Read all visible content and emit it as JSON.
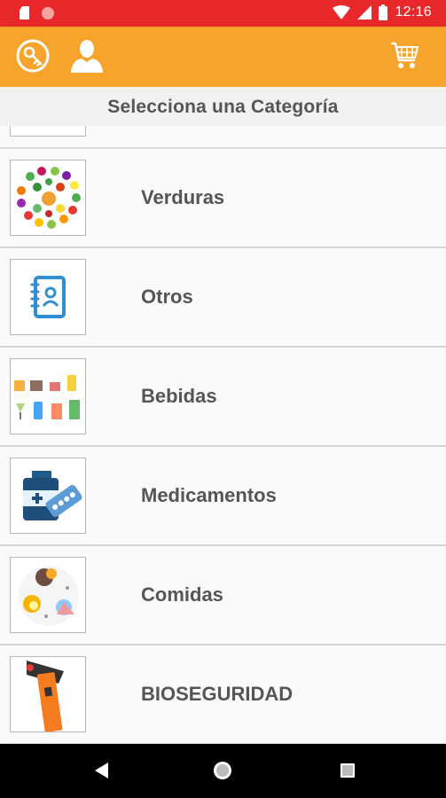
{
  "status_bar": {
    "time": "12:16",
    "color": "#e8282b"
  },
  "app_bar": {
    "color": "#f7a42d",
    "icons": [
      "key-icon",
      "user-icon",
      "cart-icon"
    ]
  },
  "header": {
    "title": "Selecciona una Categoría"
  },
  "categories": [
    {
      "label": "Verduras",
      "icon": "vegetables-image"
    },
    {
      "label": "Otros",
      "icon": "address-book-icon"
    },
    {
      "label": "Bebidas",
      "icon": "drinks-image"
    },
    {
      "label": "Medicamentos",
      "icon": "medicine-image"
    },
    {
      "label": "Comidas",
      "icon": "food-image"
    },
    {
      "label": "BIOSEGURIDAD",
      "icon": "thermometer-gun-image"
    }
  ],
  "nav_bar": {
    "icons": [
      "back-icon",
      "home-icon",
      "recents-icon"
    ]
  }
}
